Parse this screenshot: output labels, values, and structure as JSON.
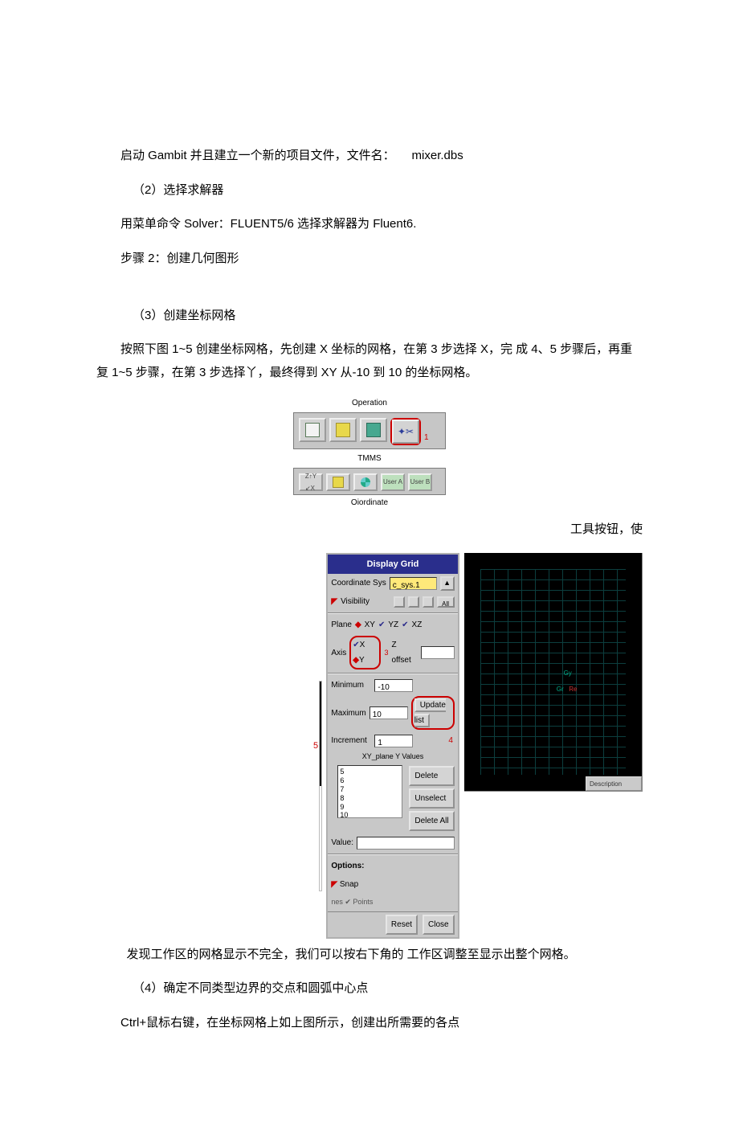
{
  "para1_a": "启动 Gambit 并且建立一个新的项目文件，文件名：",
  "para1_b": "mixer.dbs",
  "para2": "（2）选择求解器",
  "para3": "用菜单命令 Solver：FLUENT5/6 选择求解器为 Fluent6.",
  "para4": "步骤 2：创建几何图形",
  "para5": "（3）创建坐标网格",
  "para6": "按照下图 1~5 创建坐标网格，先创建  X 坐标的网格，在第 3 步选择 X，完  成 4、5 步骤后，再重复 1~5 步骤，在第 3 步选择丫，最终得到 XY 从-10 到 10 的坐标网格。",
  "fig_operation": "Operation",
  "fig_tmms": "TMMS",
  "fig_oiordinate": "Oiordinate",
  "right_frag": "工具按钮，使",
  "dg": {
    "title": "Display  Grid",
    "coord_label": "Coordinate Sys",
    "coord_value": "c_sys.1",
    "visibility": "Visibility",
    "plane": "Plane",
    "xy": "XY",
    "yz": "YZ",
    "xz": "XZ",
    "axis": "Axis",
    "x": "X",
    "y": "Y",
    "zoffset": "Z offset",
    "minimum": "Minimum",
    "min_val": "-10",
    "maximum": "Maximum",
    "max_val": "10",
    "update": "Update list",
    "increment": "Increment",
    "inc_val": "1",
    "list_title": "XY_plane Y Values",
    "list_items": [
      "5",
      "6",
      "7",
      "8",
      "9",
      "10"
    ],
    "delete": "Delete",
    "unselect": "Unselect",
    "delete_all": "Delete All",
    "value": "Value:",
    "options": "Options:",
    "snap": "Snap",
    "lines_points": "nes  ✔ Points",
    "reset": "Reset",
    "close": "Close"
  },
  "marker1": "1",
  "marker3": "3",
  "marker4": "4",
  "marker5": "5",
  "vp_foot": "Description",
  "vp_gy": "Gy",
  "vp_gr": "Gr",
  "vp_re": "Re",
  "para7": "发现工作区的网格显示不完全，我们可以按右下角的  工作区调整至显示出整个网格。",
  "para8": "（4）确定不同类型边界的交点和圆弧中心点",
  "para9": "Ctrl+鼠标右键，在坐标网格上如上图所示，创建出所需要的各点"
}
